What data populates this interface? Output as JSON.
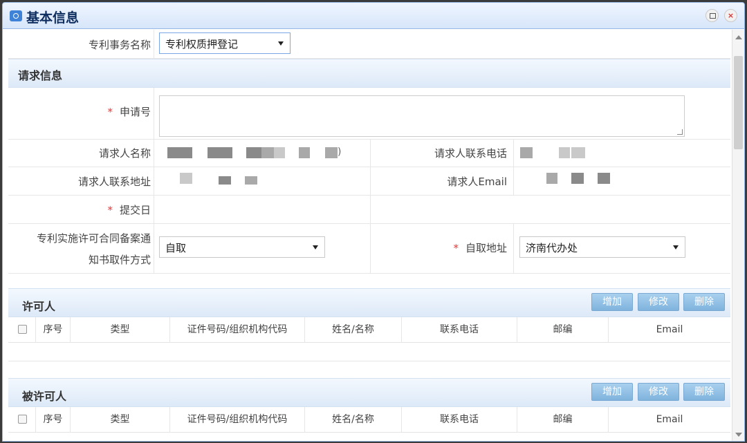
{
  "dialog": {
    "title": "基本信息"
  },
  "form": {
    "affair_label": "专利事务名称",
    "affair_value": "专利权质押登记",
    "request_section_title": "请求信息",
    "application_no_label": "申请号",
    "requester_name_label": "请求人名称",
    "requester_phone_label": "请求人联系电话",
    "requester_address_label": "请求人联系地址",
    "requester_email_label": "请求人Email",
    "submit_date_label": "提交日",
    "notice_method_label_line1": "专利实施许可合同备案通",
    "notice_method_label_line2": "知书取件方式",
    "notice_method_value": "自取",
    "pickup_address_label": "自取地址",
    "pickup_address_value": "济南代办处",
    "required_mark": "*",
    "name_suffix": ")"
  },
  "licensor": {
    "title": "许可人",
    "buttons": {
      "add": "增加",
      "edit": "修改",
      "delete": "删除"
    },
    "columns": [
      "序号",
      "类型",
      "证件号码/组织机构代码",
      "姓名/名称",
      "联系电话",
      "邮编",
      "Email"
    ]
  },
  "licensee": {
    "title": "被许可人",
    "buttons": {
      "add": "增加",
      "edit": "修改",
      "delete": "删除"
    },
    "columns": [
      "序号",
      "类型",
      "证件号码/组织机构代码",
      "姓名/名称",
      "联系电话",
      "邮编",
      "Email"
    ]
  },
  "colors": {
    "titlebar": "#d7e6fa",
    "button": "#7fb3dd",
    "required": "#e33333"
  }
}
